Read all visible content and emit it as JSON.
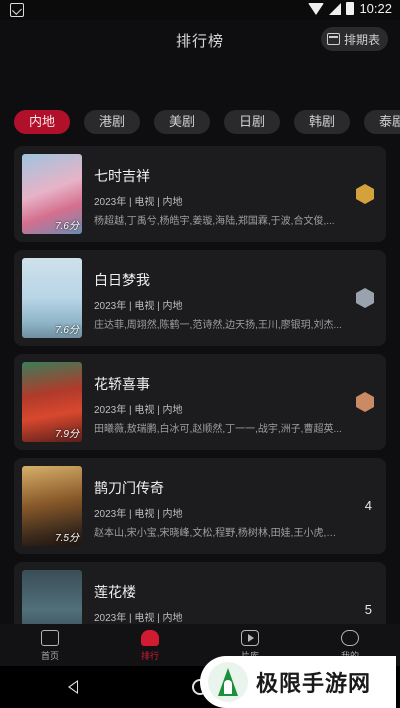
{
  "status_bar": {
    "time": "10:22"
  },
  "header": {
    "title": "排行榜",
    "schedule_label": "排期表"
  },
  "tabs": [
    {
      "label": "内地",
      "active": true
    },
    {
      "label": "港剧",
      "active": false
    },
    {
      "label": "美剧",
      "active": false
    },
    {
      "label": "日剧",
      "active": false
    },
    {
      "label": "韩剧",
      "active": false
    },
    {
      "label": "泰剧",
      "active": false
    }
  ],
  "list": [
    {
      "rank": "1",
      "title": "七时吉祥",
      "meta": "2023年 | 电视 | 内地",
      "cast": "杨超越,丁禹兮,杨皓宇,姜璇,海陆,郑国霖,于波,合文俊,...",
      "score": "7.6分",
      "badge_color": "#d4a23c"
    },
    {
      "rank": "2",
      "title": "白日梦我",
      "meta": "2023年 | 电视 | 内地",
      "cast": "庄达菲,周翊然,陈鹤一,范诗然,边天扬,王川,廖银玥,刘杰...",
      "score": "7.6分",
      "badge_color": "#9aa3ad"
    },
    {
      "rank": "3",
      "title": "花轿喜事",
      "meta": "2023年 | 电视 | 内地",
      "cast": "田曦薇,敖瑞鹏,白冰可,赵顺然,丁一一,战宇,洲子,曹超英...",
      "score": "7.9分",
      "badge_color": "#c98a64"
    },
    {
      "rank": "4",
      "title": "鹊刀门传奇",
      "meta": "2023年 | 电视 | 内地",
      "cast": "赵本山,宋小宝,宋晓峰,文松,程野,杨树林,田娃,王小虎,唐...",
      "score": "7.5分",
      "badge_color": ""
    },
    {
      "rank": "5",
      "title": "莲花楼",
      "meta": "2023年 | 电视 | 内地",
      "cast": "",
      "score": "",
      "badge_color": ""
    }
  ],
  "bottom_nav": [
    {
      "label": "首页",
      "icon": "home-icon",
      "active": false
    },
    {
      "label": "排行",
      "icon": "trophy-icon",
      "active": true
    },
    {
      "label": "片库",
      "icon": "play-icon",
      "active": false
    },
    {
      "label": "我的",
      "icon": "me-icon",
      "active": false
    }
  ],
  "watermark": {
    "text": "极限手游网"
  }
}
